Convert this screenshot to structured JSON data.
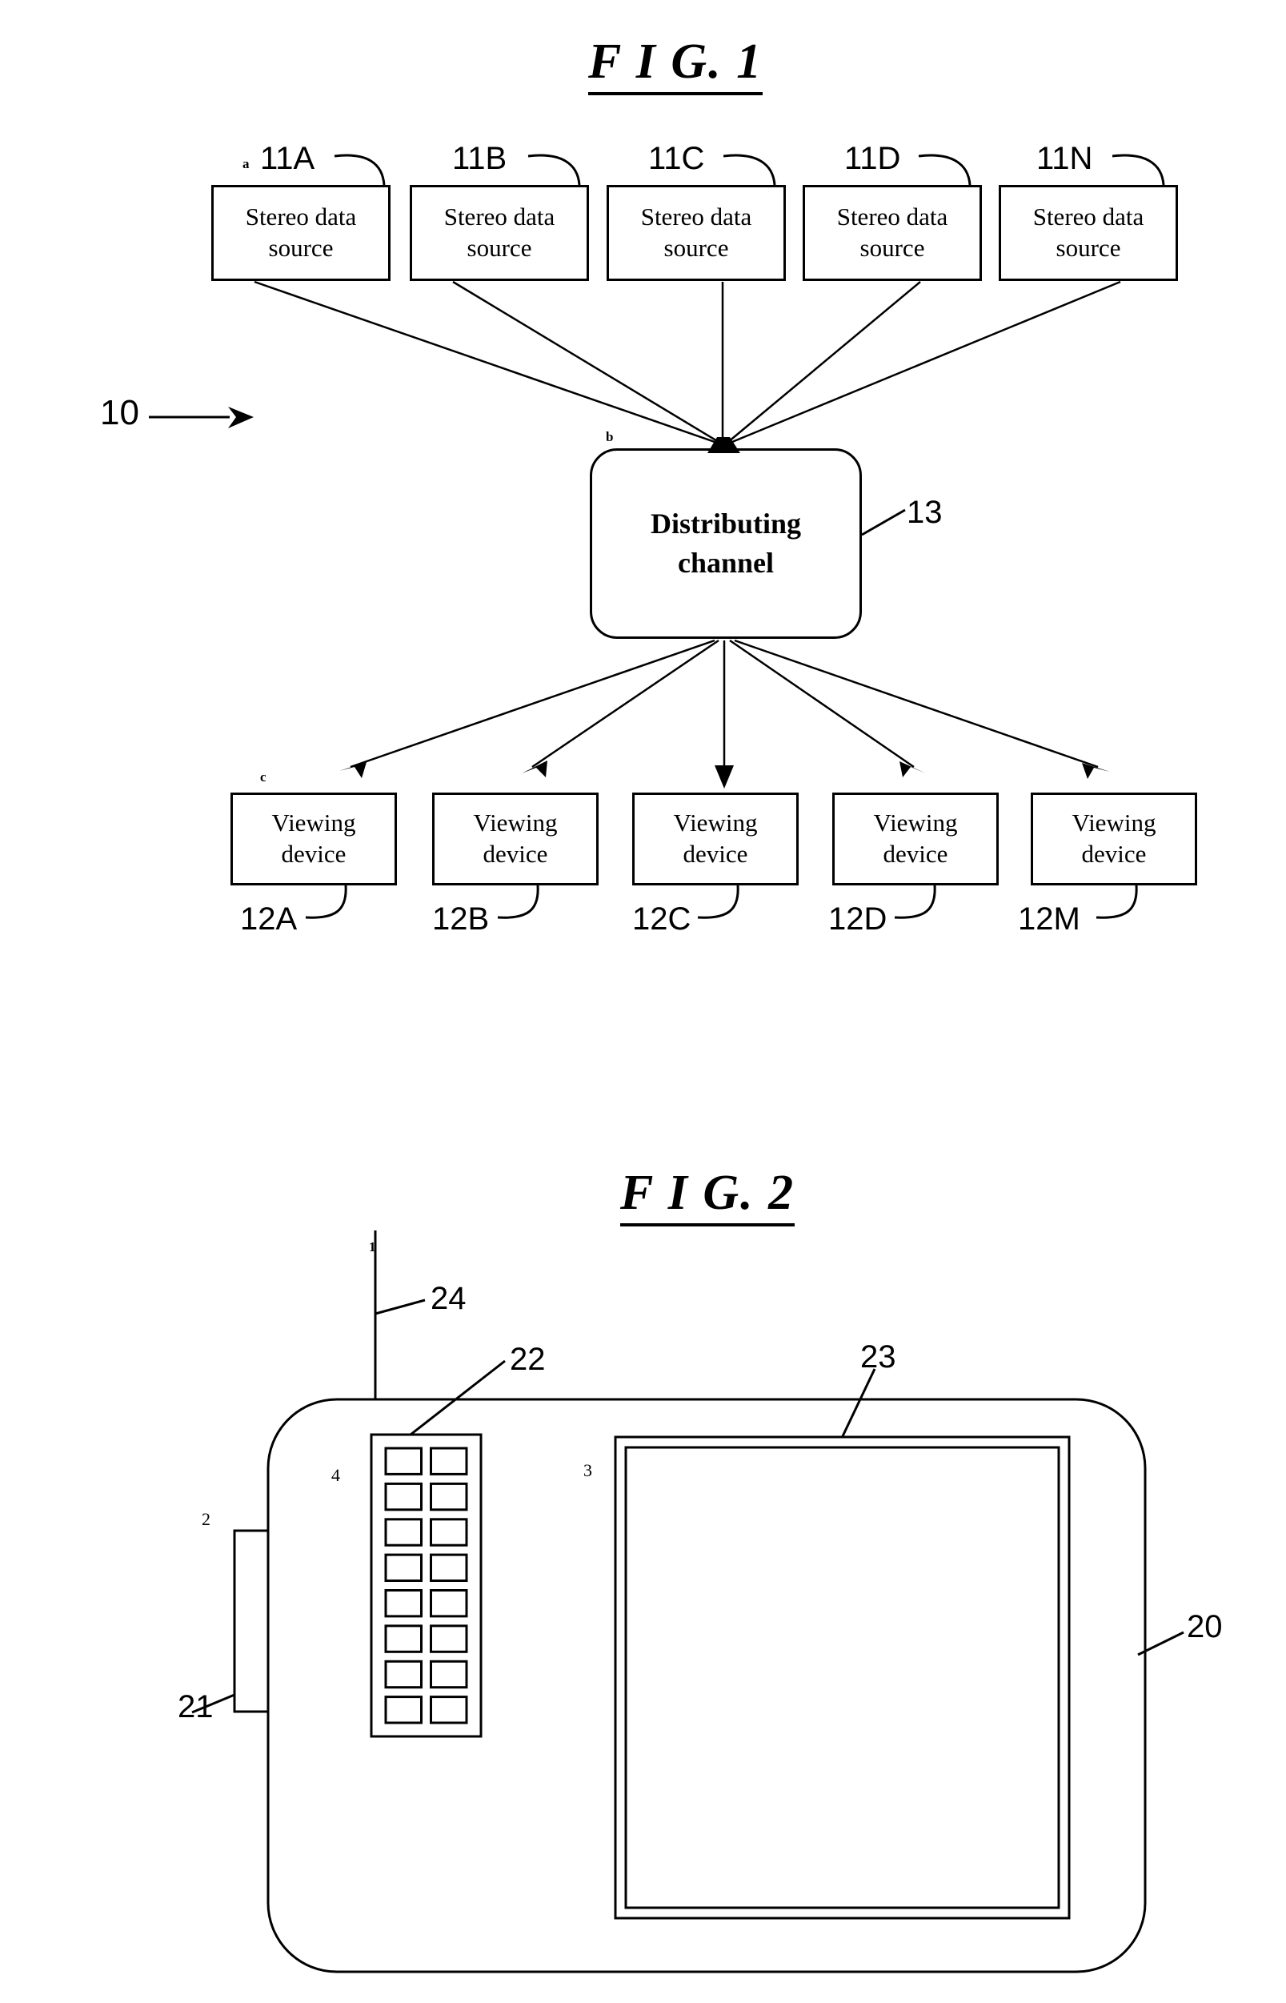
{
  "figures": [
    {
      "id": "fig1",
      "title": "F I G. 1",
      "system_ref": "10",
      "source_marker": "a",
      "channel_marker": "b",
      "device_marker": "c",
      "sources": [
        {
          "ref": "11A",
          "line1": "Stereo data",
          "line2": "source"
        },
        {
          "ref": "11B",
          "line1": "Stereo data",
          "line2": "source"
        },
        {
          "ref": "11C",
          "line1": "Stereo data",
          "line2": "source"
        },
        {
          "ref": "11D",
          "line1": "Stereo data",
          "line2": "source"
        },
        {
          "ref": "11N",
          "line1": "Stereo data",
          "line2": "source"
        }
      ],
      "channel": {
        "ref": "13",
        "line1": "Distributing",
        "line2": "channel"
      },
      "viewers": [
        {
          "ref": "12A",
          "line1": "Viewing",
          "line2": "device"
        },
        {
          "ref": "12B",
          "line1": "Viewing",
          "line2": "device"
        },
        {
          "ref": "12C",
          "line1": "Viewing",
          "line2": "device"
        },
        {
          "ref": "12D",
          "line1": "Viewing",
          "line2": "device"
        },
        {
          "ref": "12M",
          "line1": "Viewing",
          "line2": "device"
        }
      ]
    },
    {
      "id": "fig2",
      "title": "F I G. 2",
      "body_ref": "20",
      "antenna_ref": "24",
      "antenna_marker": "1",
      "connector_ref": "21",
      "connector_marker": "2",
      "keypad_ref": "22",
      "keypad_marker": "4",
      "screen_ref": "23",
      "screen_marker": "3",
      "keypad_rows": 8,
      "keypad_cols": 2
    }
  ],
  "colors": {
    "ink": "#000000",
    "paper": "#ffffff"
  }
}
